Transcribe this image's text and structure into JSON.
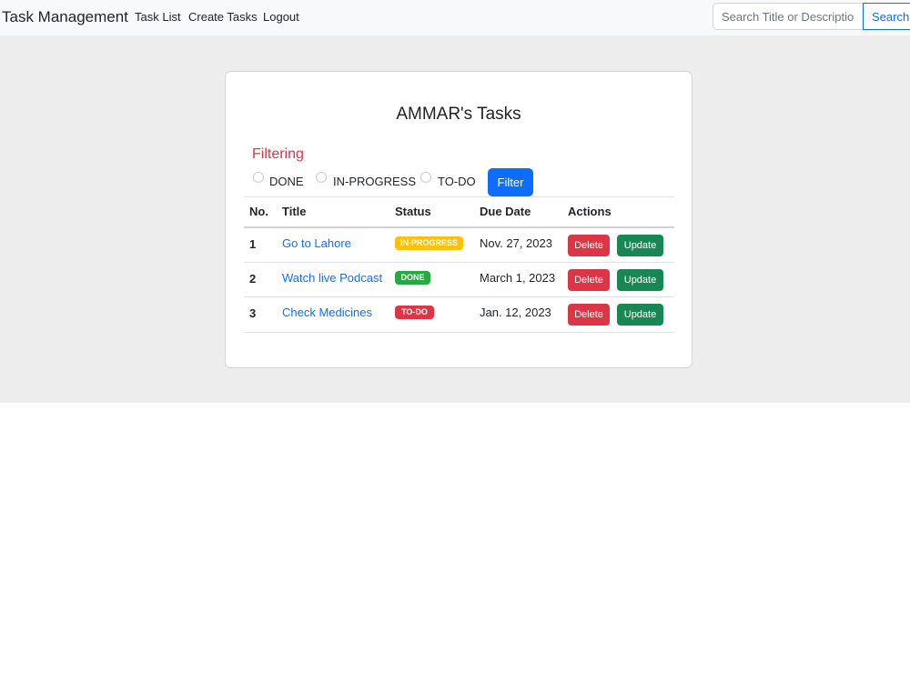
{
  "navbar": {
    "brand": "Task Management",
    "links": [
      "Task List",
      "Create Tasks",
      "Logout"
    ],
    "search_placeholder": "Search Title or Description",
    "search_button": "Search"
  },
  "card": {
    "title": "AMMAR's Tasks",
    "filtering": {
      "heading": "Filtering",
      "options": [
        "DONE",
        "IN-PROGRESS",
        "TO-DO"
      ],
      "button": "Filter"
    },
    "table": {
      "headers": [
        "No.",
        "Title",
        "Status",
        "Due Date",
        "Actions"
      ],
      "rows": [
        {
          "no": "1",
          "title": "Go to Lahore",
          "status": "IN-PROGRESS",
          "due": "Nov. 27, 2023",
          "delete": "Delete",
          "update": "Update"
        },
        {
          "no": "2",
          "title": "Watch live Podcast",
          "status": "DONE",
          "due": "March 1, 2023",
          "delete": "Delete",
          "update": "Update"
        },
        {
          "no": "3",
          "title": "Check Medicines",
          "status": "TO-DO",
          "due": "Jan. 12, 2023",
          "delete": "Delete",
          "update": "Update"
        }
      ]
    }
  },
  "colors": {
    "primary": "#0d6efd",
    "danger": "#dc3545",
    "success": "#198754",
    "badge_in_progress": "#ffc107",
    "badge_done": "#28a745",
    "badge_todo": "#dc3545"
  }
}
